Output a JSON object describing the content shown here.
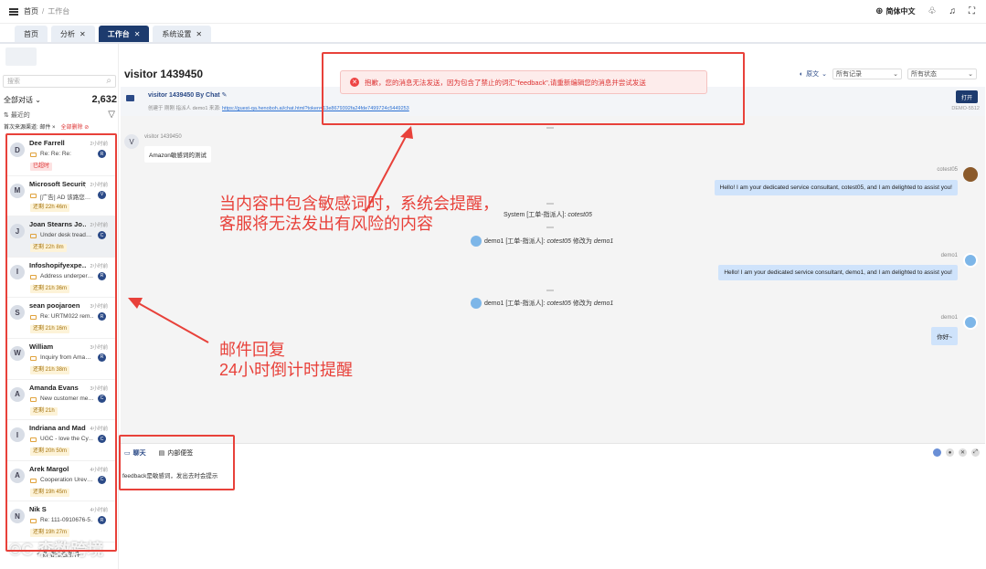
{
  "breadcrumb": {
    "home": "首页",
    "sep": "/",
    "current": "工作台"
  },
  "topbar": {
    "language": "简体中文"
  },
  "tabs": [
    {
      "label": "首页",
      "closable": false,
      "active": false
    },
    {
      "label": "分析",
      "closable": true,
      "active": false
    },
    {
      "label": "工作台",
      "closable": true,
      "active": true
    },
    {
      "label": "系统设置",
      "closable": true,
      "active": false
    }
  ],
  "sidebar": {
    "search_placeholder": "搜索",
    "all_conversations": "全部对话",
    "count": "2,632",
    "recent": "最近的",
    "filter_tag": "首次来源渠道: 邮件",
    "filter_clear": "全部删除",
    "add_label": "+ 新增筛选条件",
    "conversations": [
      {
        "initial": "D",
        "name": "Dee Farrell",
        "time": "2小时前",
        "subject": "Re: Re: Re:",
        "badge": "R",
        "due": "已超时",
        "overdue": true
      },
      {
        "initial": "M",
        "name": "Microsoft Security",
        "time": "2小时前",
        "subject": "[广告] AD 该路您…",
        "badge": "V",
        "due": "还剩 22h 46m",
        "overdue": false
      },
      {
        "initial": "J",
        "name": "Joan Stearns Jo…",
        "time": "2小时前",
        "subject": "Under desk tread…",
        "badge": "C",
        "due": "还剩 22h 8m",
        "overdue": false
      },
      {
        "initial": "I",
        "name": "Infoshopifyexpe…",
        "time": "2小时前",
        "subject": "Address underper…",
        "badge": "R",
        "due": "还剩 21h 36m",
        "overdue": false
      },
      {
        "initial": "S",
        "name": "sean poojaroen",
        "time": "3小时前",
        "subject": "Re: URTM022 rem…",
        "badge": "R",
        "due": "还剩 21h 16m",
        "overdue": false
      },
      {
        "initial": "W",
        "name": "William",
        "time": "3小时前",
        "subject": "Inquiry from Ama…",
        "badge": "R",
        "due": "还剩 21h 38m",
        "overdue": false
      },
      {
        "initial": "A",
        "name": "Amanda Evans",
        "time": "3小时前",
        "subject": "New customer me…",
        "badge": "C",
        "due": "还剩 21h",
        "overdue": false
      },
      {
        "initial": "I",
        "name": "Indriana and Madi",
        "time": "4小时前",
        "subject": "UGC - love the Cy…",
        "badge": "C",
        "due": "还剩 20h 50m",
        "overdue": false
      },
      {
        "initial": "A",
        "name": "Arek Margol",
        "time": "4小时前",
        "subject": "Cooperation Urev…",
        "badge": "C",
        "due": "还剩 19h 45m",
        "overdue": false
      },
      {
        "initial": "N",
        "name": "Nik S",
        "time": "4小时前",
        "subject": "Re: 111-0910676-5…",
        "badge": "R",
        "due": "还剩 19h 27m",
        "overdue": false
      }
    ]
  },
  "watermark": "©C 森数跨境",
  "main": {
    "title": "visitor 1439450",
    "translate_label": "原文",
    "select_records": "所有记录",
    "select_status": "所有状态",
    "info_title": "visitor 1439450 By Chat",
    "info_meta_prefix": "创建于 刚刚   指派人 demo1   来源:",
    "info_link": "https://guest-qa.henoboh.ai/chat.html?token=13e8679392fa24fde7499724c5449253",
    "open_button": "打开",
    "demo_id": "DEMO-5512"
  },
  "toast": {
    "message": "抱歉，您的消息无法发送，因为包含了禁止的词汇\"feedback\",请重新编辑您的消息并尝试发送"
  },
  "chat": {
    "visitor_initial": "V",
    "visitor_name": "visitor 1439450",
    "visitor_msg": "Amazon敏感词的测试",
    "agent1_name": "cotest05",
    "agent1_msg": "Hello! I am your dedicated service consultant, cotest05, and I am delighted to assist you!",
    "sys1": "System [工单-指派人]: ",
    "sys1_italic": "cotest05",
    "sys2_a": "demo1 [工单-指派人]: ",
    "sys2_b": "cotest05",
    "sys2_c": " 修改为 ",
    "sys2_d": "demo1",
    "agent2_name": "demo1",
    "agent2_msg": "Hello! I am your dedicated service consultant, demo1, and I am delighted to assist you!",
    "agent3_name": "demo1",
    "agent3_msg": "你好~"
  },
  "composer": {
    "tab_chat": "聊天",
    "tab_note": "内部便签",
    "text": "feedback是敏感词，发出去时会提示"
  },
  "annotations": {
    "sensitive_line1": "当内容中包含敏感词时，系统会提醒，",
    "sensitive_line2": "客服将无法发出有风险的内容",
    "email_line1": "邮件回复",
    "email_line2": "24小时倒计时提醒"
  },
  "colors": {
    "accent": "#1d3b6e",
    "annotation_red": "#e8413a",
    "bubble": "#cfe3fb"
  }
}
